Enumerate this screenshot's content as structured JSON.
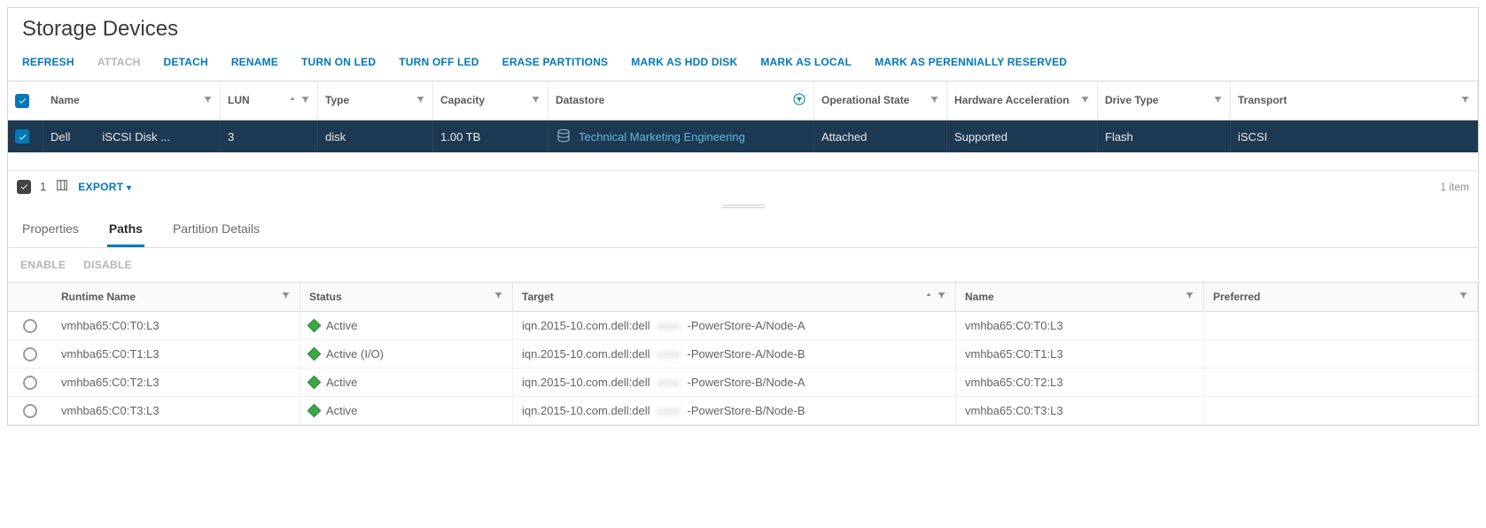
{
  "page": {
    "title": "Storage Devices"
  },
  "toolbar": {
    "refresh": "REFRESH",
    "attach": "ATTACH",
    "detach": "DETACH",
    "rename": "RENAME",
    "turn_on_led": "TURN ON LED",
    "turn_off_led": "TURN OFF LED",
    "erase_partitions": "ERASE PARTITIONS",
    "mark_hdd": "MARK AS HDD DISK",
    "mark_local": "MARK AS LOCAL",
    "mark_perennial": "MARK AS PERENNIALLY RESERVED"
  },
  "devices": {
    "columns": {
      "name": "Name",
      "lun": "LUN",
      "type": "Type",
      "capacity": "Capacity",
      "datastore": "Datastore",
      "op_state": "Operational State",
      "hw_accel": "Hardware Acceleration",
      "drive_type": "Drive Type",
      "transport": "Transport"
    },
    "row0": {
      "vendor": "Dell",
      "disk": "iSCSI Disk ...",
      "lun": "3",
      "type": "disk",
      "capacity": "1.00 TB",
      "datastore": "Technical Marketing Engineering",
      "op_state": "Attached",
      "hw_accel": "Supported",
      "drive_type": "Flash",
      "transport": "iSCSI"
    },
    "footer": {
      "selected_count": "1",
      "export": "EXPORT",
      "item_count": "1 item"
    }
  },
  "tabs": {
    "properties": "Properties",
    "paths": "Paths",
    "partition": "Partition Details"
  },
  "paths_actions": {
    "enable": "ENABLE",
    "disable": "DISABLE"
  },
  "paths": {
    "columns": {
      "runtime_name": "Runtime Name",
      "status": "Status",
      "target": "Target",
      "name": "Name",
      "preferred": "Preferred"
    },
    "r0": {
      "runtime_name": "vmhba65:C0:T0:L3",
      "status": "Active",
      "target_pre": "iqn.2015-10.com.dell:dell",
      "target_suf": "-PowerStore-A/Node-A",
      "name": "vmhba65:C0:T0:L3"
    },
    "r1": {
      "runtime_name": "vmhba65:C0:T1:L3",
      "status": "Active (I/O)",
      "target_pre": "iqn.2015-10.com.dell:dell",
      "target_suf": "-PowerStore-A/Node-B",
      "name": "vmhba65:C0:T1:L3"
    },
    "r2": {
      "runtime_name": "vmhba65:C0:T2:L3",
      "status": "Active",
      "target_pre": "iqn.2015-10.com.dell:dell",
      "target_suf": "-PowerStore-B/Node-A",
      "name": "vmhba65:C0:T2:L3"
    },
    "r3": {
      "runtime_name": "vmhba65:C0:T3:L3",
      "status": "Active",
      "target_pre": "iqn.2015-10.com.dell:dell",
      "target_suf": "-PowerStore-B/Node-B",
      "name": "vmhba65:C0:T3:L3"
    }
  }
}
